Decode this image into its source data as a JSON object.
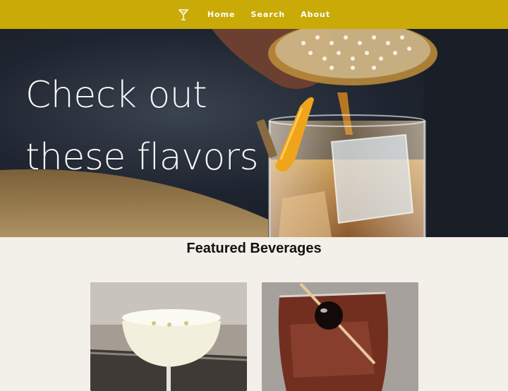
{
  "navbar": {
    "logo_icon": "cocktail-glass-icon",
    "links": [
      {
        "label": "Home"
      },
      {
        "label": "Search"
      },
      {
        "label": "About"
      }
    ],
    "background": "#c9aa07"
  },
  "hero": {
    "title": "Check out\nthese flavors",
    "image": "whiskey-pour-over-ice-photo"
  },
  "featured": {
    "heading": "Featured Beverages",
    "cards": [
      {
        "image": "white-foam-coupe-cocktail-photo"
      },
      {
        "image": "old-fashioned-with-cherry-photo"
      }
    ]
  },
  "colors": {
    "page_background": "#f3efe9",
    "accent": "#c9aa07"
  }
}
